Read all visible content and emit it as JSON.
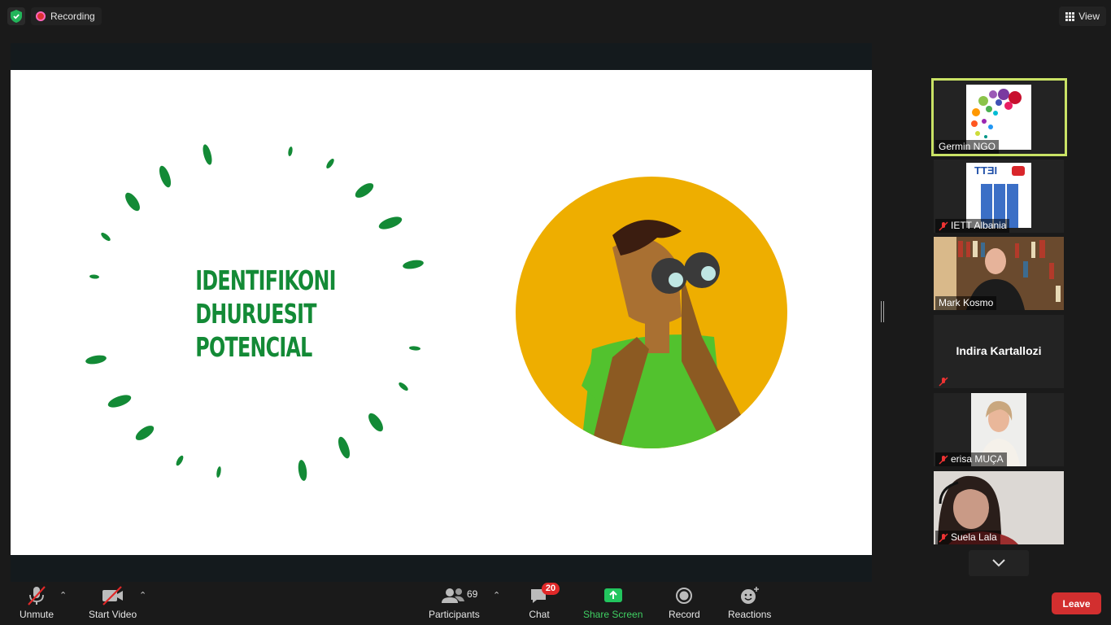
{
  "topbar": {
    "recording_label": "Recording",
    "view_label": "View"
  },
  "slide": {
    "title_lines": [
      "IDENTIFIKONI",
      "DHURUESIT",
      "POTENCIAL"
    ],
    "accent_color": "#138a36"
  },
  "gallery": [
    {
      "name": "Germin NGO",
      "muted": false,
      "active": true
    },
    {
      "name": "IETT Albania",
      "muted": true,
      "logo_text": "IETT"
    },
    {
      "name": "Mark Kosmo",
      "muted": false
    },
    {
      "name": "Indira Kartallozi",
      "muted": true,
      "video": false
    },
    {
      "name": "erisa MUÇA",
      "muted": true
    },
    {
      "name": "Suela Lala",
      "muted": true
    }
  ],
  "toolbar": {
    "unmute_label": "Unmute",
    "start_video_label": "Start Video",
    "participants_label": "Participants",
    "participants_count": "69",
    "chat_label": "Chat",
    "chat_badge": "20",
    "share_label": "Share Screen",
    "record_label": "Record",
    "reactions_label": "Reactions",
    "leave_label": "Leave"
  },
  "colors": {
    "active_speaker_border": "#c9e265",
    "share_green": "#3fcf62",
    "leave_red": "#d22f2f",
    "badge_red": "#e02828"
  }
}
